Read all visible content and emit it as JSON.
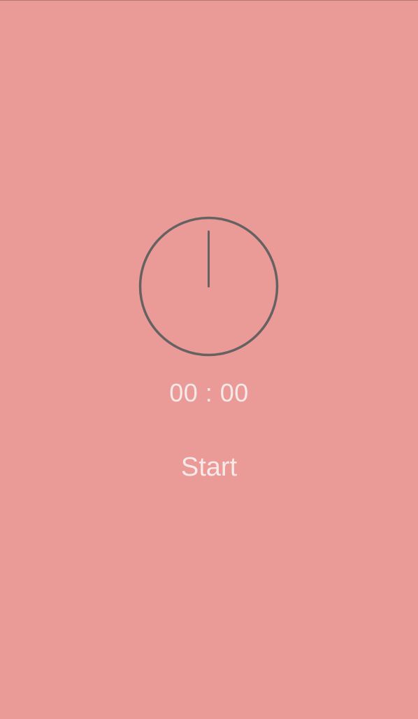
{
  "timer": {
    "display": "00 : 00",
    "elapsed_fraction": 0
  },
  "actions": {
    "start_label": "Start"
  },
  "colors": {
    "background": "#EA9A97",
    "dial_stroke": "#666262",
    "text": "#F6E9E8"
  }
}
